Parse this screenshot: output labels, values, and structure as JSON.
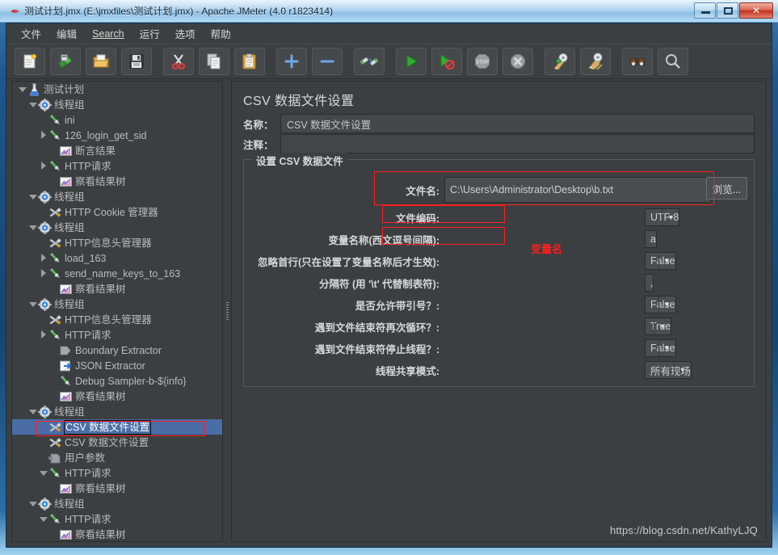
{
  "window": {
    "title": "测试计划.jmx (E:\\jmxfiles\\测试计划.jmx) - Apache JMeter (4.0 r1823414)",
    "app_icon": "jmeter-feather-icon",
    "controls": {
      "minimize": "minimize-button",
      "maximize": "maximize-button",
      "close": "close-button"
    }
  },
  "menu": {
    "items": [
      {
        "label": "文件",
        "mnemonic": ""
      },
      {
        "label": "编辑",
        "mnemonic": ""
      },
      {
        "label": "Search",
        "mnemonic": "S"
      },
      {
        "label": "运行",
        "mnemonic": ""
      },
      {
        "label": "选项",
        "mnemonic": ""
      },
      {
        "label": "帮助",
        "mnemonic": ""
      }
    ]
  },
  "toolbar": {
    "buttons": [
      {
        "name": "new-icon",
        "tip": "新建"
      },
      {
        "name": "templates-icon",
        "tip": "模板"
      },
      {
        "name": "open-icon",
        "tip": "打开"
      },
      {
        "name": "save-icon",
        "tip": "保存"
      },
      {
        "name": "cut-icon",
        "tip": "剪切"
      },
      {
        "name": "copy-icon",
        "tip": "复制"
      },
      {
        "name": "paste-icon",
        "tip": "粘贴"
      },
      {
        "name": "expand-all-icon",
        "tip": "展开全部"
      },
      {
        "name": "collapse-all-icon",
        "tip": "折叠全部"
      },
      {
        "name": "toggle-icon",
        "tip": "开关"
      },
      {
        "name": "start-icon",
        "tip": "启动"
      },
      {
        "name": "start-no-pause-icon",
        "tip": "无间隔启动"
      },
      {
        "name": "stop-icon",
        "tip": "停止"
      },
      {
        "name": "shutdown-icon",
        "tip": "关闭"
      },
      {
        "name": "clear-icon",
        "tip": "清除"
      },
      {
        "name": "clear-all-icon",
        "tip": "清除全部"
      },
      {
        "name": "search-icon",
        "tip": "查找"
      },
      {
        "name": "reset-search-icon",
        "tip": "重置查找"
      }
    ]
  },
  "tree": {
    "nodes": [
      {
        "indent": 0,
        "twisty": "down",
        "icon": "test-plan-icon",
        "label": "测试计划",
        "selected": false
      },
      {
        "indent": 1,
        "twisty": "down",
        "icon": "thread-group-icon",
        "label": "线程组",
        "selected": false
      },
      {
        "indent": 2,
        "twisty": "none",
        "icon": "sampler-icon",
        "label": "ini",
        "selected": false
      },
      {
        "indent": 2,
        "twisty": "right",
        "icon": "sampler-icon",
        "label": "126_login_get_sid",
        "selected": false
      },
      {
        "indent": 3,
        "twisty": "none",
        "icon": "listener-icon",
        "label": "断言结果",
        "selected": false
      },
      {
        "indent": 2,
        "twisty": "right",
        "icon": "sampler-icon",
        "label": "HTTP请求",
        "selected": false
      },
      {
        "indent": 3,
        "twisty": "none",
        "icon": "listener-icon",
        "label": "察看结果树",
        "selected": false
      },
      {
        "indent": 1,
        "twisty": "down",
        "icon": "thread-group-icon",
        "label": "线程组",
        "selected": false
      },
      {
        "indent": 2,
        "twisty": "none",
        "icon": "config-element-icon",
        "label": "HTTP Cookie 管理器",
        "selected": false
      },
      {
        "indent": 1,
        "twisty": "down",
        "icon": "thread-group-icon",
        "label": "线程组",
        "selected": false
      },
      {
        "indent": 2,
        "twisty": "none",
        "icon": "config-element-icon",
        "label": "HTTP信息头管理器",
        "selected": false
      },
      {
        "indent": 2,
        "twisty": "right",
        "icon": "sampler-icon",
        "label": "load_163",
        "selected": false
      },
      {
        "indent": 2,
        "twisty": "right",
        "icon": "sampler-icon",
        "label": "send_name_keys_to_163",
        "selected": false
      },
      {
        "indent": 3,
        "twisty": "none",
        "icon": "listener-icon",
        "label": "察看结果树",
        "selected": false
      },
      {
        "indent": 1,
        "twisty": "down",
        "icon": "thread-group-icon",
        "label": "线程组",
        "selected": false
      },
      {
        "indent": 2,
        "twisty": "none",
        "icon": "config-element-icon",
        "label": "HTTP信息头管理器",
        "selected": false
      },
      {
        "indent": 2,
        "twisty": "right",
        "icon": "sampler-icon",
        "label": "HTTP请求",
        "selected": false
      },
      {
        "indent": 3,
        "twisty": "none",
        "icon": "post-processor-icon",
        "label": "Boundary Extractor",
        "selected": false
      },
      {
        "indent": 3,
        "twisty": "none",
        "icon": "json-extractor-icon",
        "label": "JSON Extractor",
        "selected": false
      },
      {
        "indent": 3,
        "twisty": "none",
        "icon": "sampler-icon",
        "label": "Debug Sampler-b-${info}",
        "selected": false
      },
      {
        "indent": 3,
        "twisty": "none",
        "icon": "listener-icon",
        "label": "察看结果树",
        "selected": false
      },
      {
        "indent": 1,
        "twisty": "down",
        "icon": "thread-group-icon",
        "label": "线程组",
        "selected": false
      },
      {
        "indent": 2,
        "twisty": "none",
        "icon": "config-element-icon",
        "label": "CSV 数据文件设置",
        "selected": true
      },
      {
        "indent": 2,
        "twisty": "none",
        "icon": "config-element-icon",
        "label": "CSV 数据文件设置",
        "selected": false
      },
      {
        "indent": 2,
        "twisty": "none",
        "icon": "user-params-icon",
        "label": "用户参数",
        "selected": false
      },
      {
        "indent": 2,
        "twisty": "down",
        "icon": "sampler-icon",
        "label": "HTTP请求",
        "selected": false
      },
      {
        "indent": 3,
        "twisty": "none",
        "icon": "listener-icon",
        "label": "察看结果树",
        "selected": false
      },
      {
        "indent": 1,
        "twisty": "down",
        "icon": "thread-group-icon",
        "label": "线程组",
        "selected": false
      },
      {
        "indent": 2,
        "twisty": "down",
        "icon": "sampler-icon",
        "label": "HTTP请求",
        "selected": false
      },
      {
        "indent": 3,
        "twisty": "none",
        "icon": "listener-icon",
        "label": "察看结果树",
        "selected": false
      }
    ]
  },
  "panel": {
    "title": "CSV 数据文件设置",
    "name_label": "名称：",
    "name_value": "CSV 数据文件设置",
    "comment_label": "注释：",
    "comment_value": "",
    "group_title": "设置 CSV 数据文件",
    "browse_label": "浏览...",
    "fields": [
      {
        "label": "文件名:",
        "value": "C:\\Users\\Administrator\\Desktop\\b.txt",
        "type": "text-with-browse"
      },
      {
        "label": "文件编码:",
        "value": "UTF-8",
        "type": "combo"
      },
      {
        "label": "变量名称(西文逗号间隔):",
        "value": "a",
        "type": "text"
      },
      {
        "label": "忽略首行(只在设置了变量名称后才生效):",
        "value": "False",
        "type": "combo"
      },
      {
        "label": "分隔符 (用 '\\t' 代替制表符):",
        "value": ",",
        "type": "text"
      },
      {
        "label": "是否允许带引号？:",
        "value": "False",
        "type": "combo"
      },
      {
        "label": "遇到文件结束符再次循环？:",
        "value": "True",
        "type": "combo"
      },
      {
        "label": "遇到文件结束符停止线程？:",
        "value": "False",
        "type": "combo"
      },
      {
        "label": "线程共享模式:",
        "value": "所有现场",
        "type": "combo"
      }
    ]
  },
  "annotations": {
    "color": "#ff1d1d",
    "note_text": "变量名"
  },
  "watermark": "https://blog.csdn.net/KathyLJQ"
}
